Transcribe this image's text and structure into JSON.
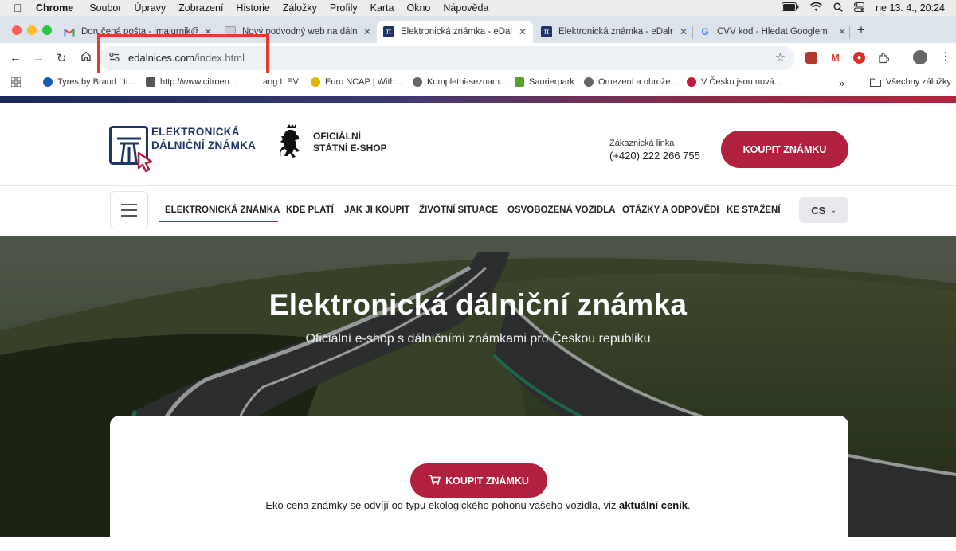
{
  "menubar": {
    "app": "Chrome",
    "items": [
      "Soubor",
      "Úpravy",
      "Zobrazení",
      "Historie",
      "Záložky",
      "Profily",
      "Karta",
      "Okno",
      "Nápověda"
    ],
    "clock": "ne 13. 4., 20:24"
  },
  "tabs": [
    {
      "title": "Doručená pošta - jmajurnik@",
      "icon": "gmail-icon",
      "active": false
    },
    {
      "title": "Nový podvodný web na dálni",
      "icon": "document-icon",
      "active": false
    },
    {
      "title": "Elektronická známka - eDalni",
      "icon": "edalnice-icon",
      "active": true
    },
    {
      "title": "Elektronická známka - eDalni",
      "icon": "edalnice-icon",
      "active": false
    },
    {
      "title": "CVV kod - Hledat Googlem",
      "icon": "google-icon",
      "active": false
    }
  ],
  "omnibox": {
    "host": "edalnices.com",
    "path": "/index.html"
  },
  "bookmarks": [
    {
      "label": "Tyres by Brand | ti...",
      "color": "#1a5bb0"
    },
    {
      "label": "http://www.citroen...",
      "color": "#555555"
    },
    {
      "label": "ang L EV",
      "color": "#888888"
    },
    {
      "label": "Euro NCAP | With...",
      "color": "#e0b800"
    },
    {
      "label": "Kompletni-seznam...",
      "color": "#666666"
    },
    {
      "label": "Saurierpark",
      "color": "#5aa02c"
    },
    {
      "label": "Omezení a ohrože...",
      "color": "#666666"
    },
    {
      "label": "V Česku jsou nová...",
      "color": "#c4153c"
    }
  ],
  "bookmarks_all": "Všechny záložky",
  "site": {
    "logo_line1": "ELEKTRONICKÁ",
    "logo_line2": "DÁLNIČNÍ ZNÁMKA",
    "eshop_line1": "OFICIÁLNÍ",
    "eshop_line2": "STÁTNÍ E-SHOP",
    "hotline_label": "Zákaznická linka",
    "hotline": "(+420) 222 266 755",
    "buy_label": "KOUPIT ZNÁMKU",
    "nav": [
      "ELEKTRONICKÁ ZNÁMKA",
      "KDE PLATÍ",
      "JAK JI KOUPIT",
      "ŽIVOTNÍ SITUACE",
      "OSVOBOZENÁ VOZIDLA",
      "OTÁZKY A ODPOVĚDI",
      "KE STAŽENÍ"
    ],
    "lang": "CS",
    "hero_title": "Elektronická dálniční známka",
    "hero_subtitle": "Oficiální e-shop s dálničními známkami pro Českou republiku",
    "card_buy_label": "KOUPIT ZNÁMKU",
    "eko_text": "Eko cena známky se odvíjí od typu ekologického pohonu vašeho vozidla, viz ",
    "eko_link": "aktuální ceník",
    "eko_end": "."
  },
  "colors": {
    "accent": "#b1213f",
    "brand_blue": "#1e3366",
    "highlight": "#e53a24"
  }
}
